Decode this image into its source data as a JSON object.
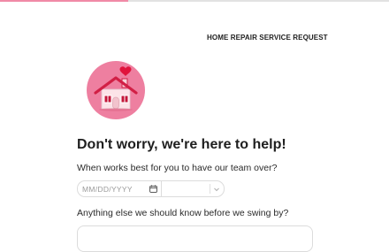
{
  "progress": {
    "fraction": 0.33,
    "fill_color": "#f08aa6",
    "track_color": "#e2e2e2"
  },
  "header": {
    "form_title": "HOME REPAIR SERVICE REQUEST"
  },
  "logo": {
    "icon": "house-with-heart-icon",
    "circle_color": "#ee7fa0"
  },
  "main": {
    "headline": "Don't worry, we're here to help!",
    "question_schedule": "When works best for you to have our team over?",
    "date_placeholder": "MM/DD/YYYY",
    "time_value": "",
    "question_notes": "Anything else we should know before we swing by?",
    "notes_value": ""
  }
}
